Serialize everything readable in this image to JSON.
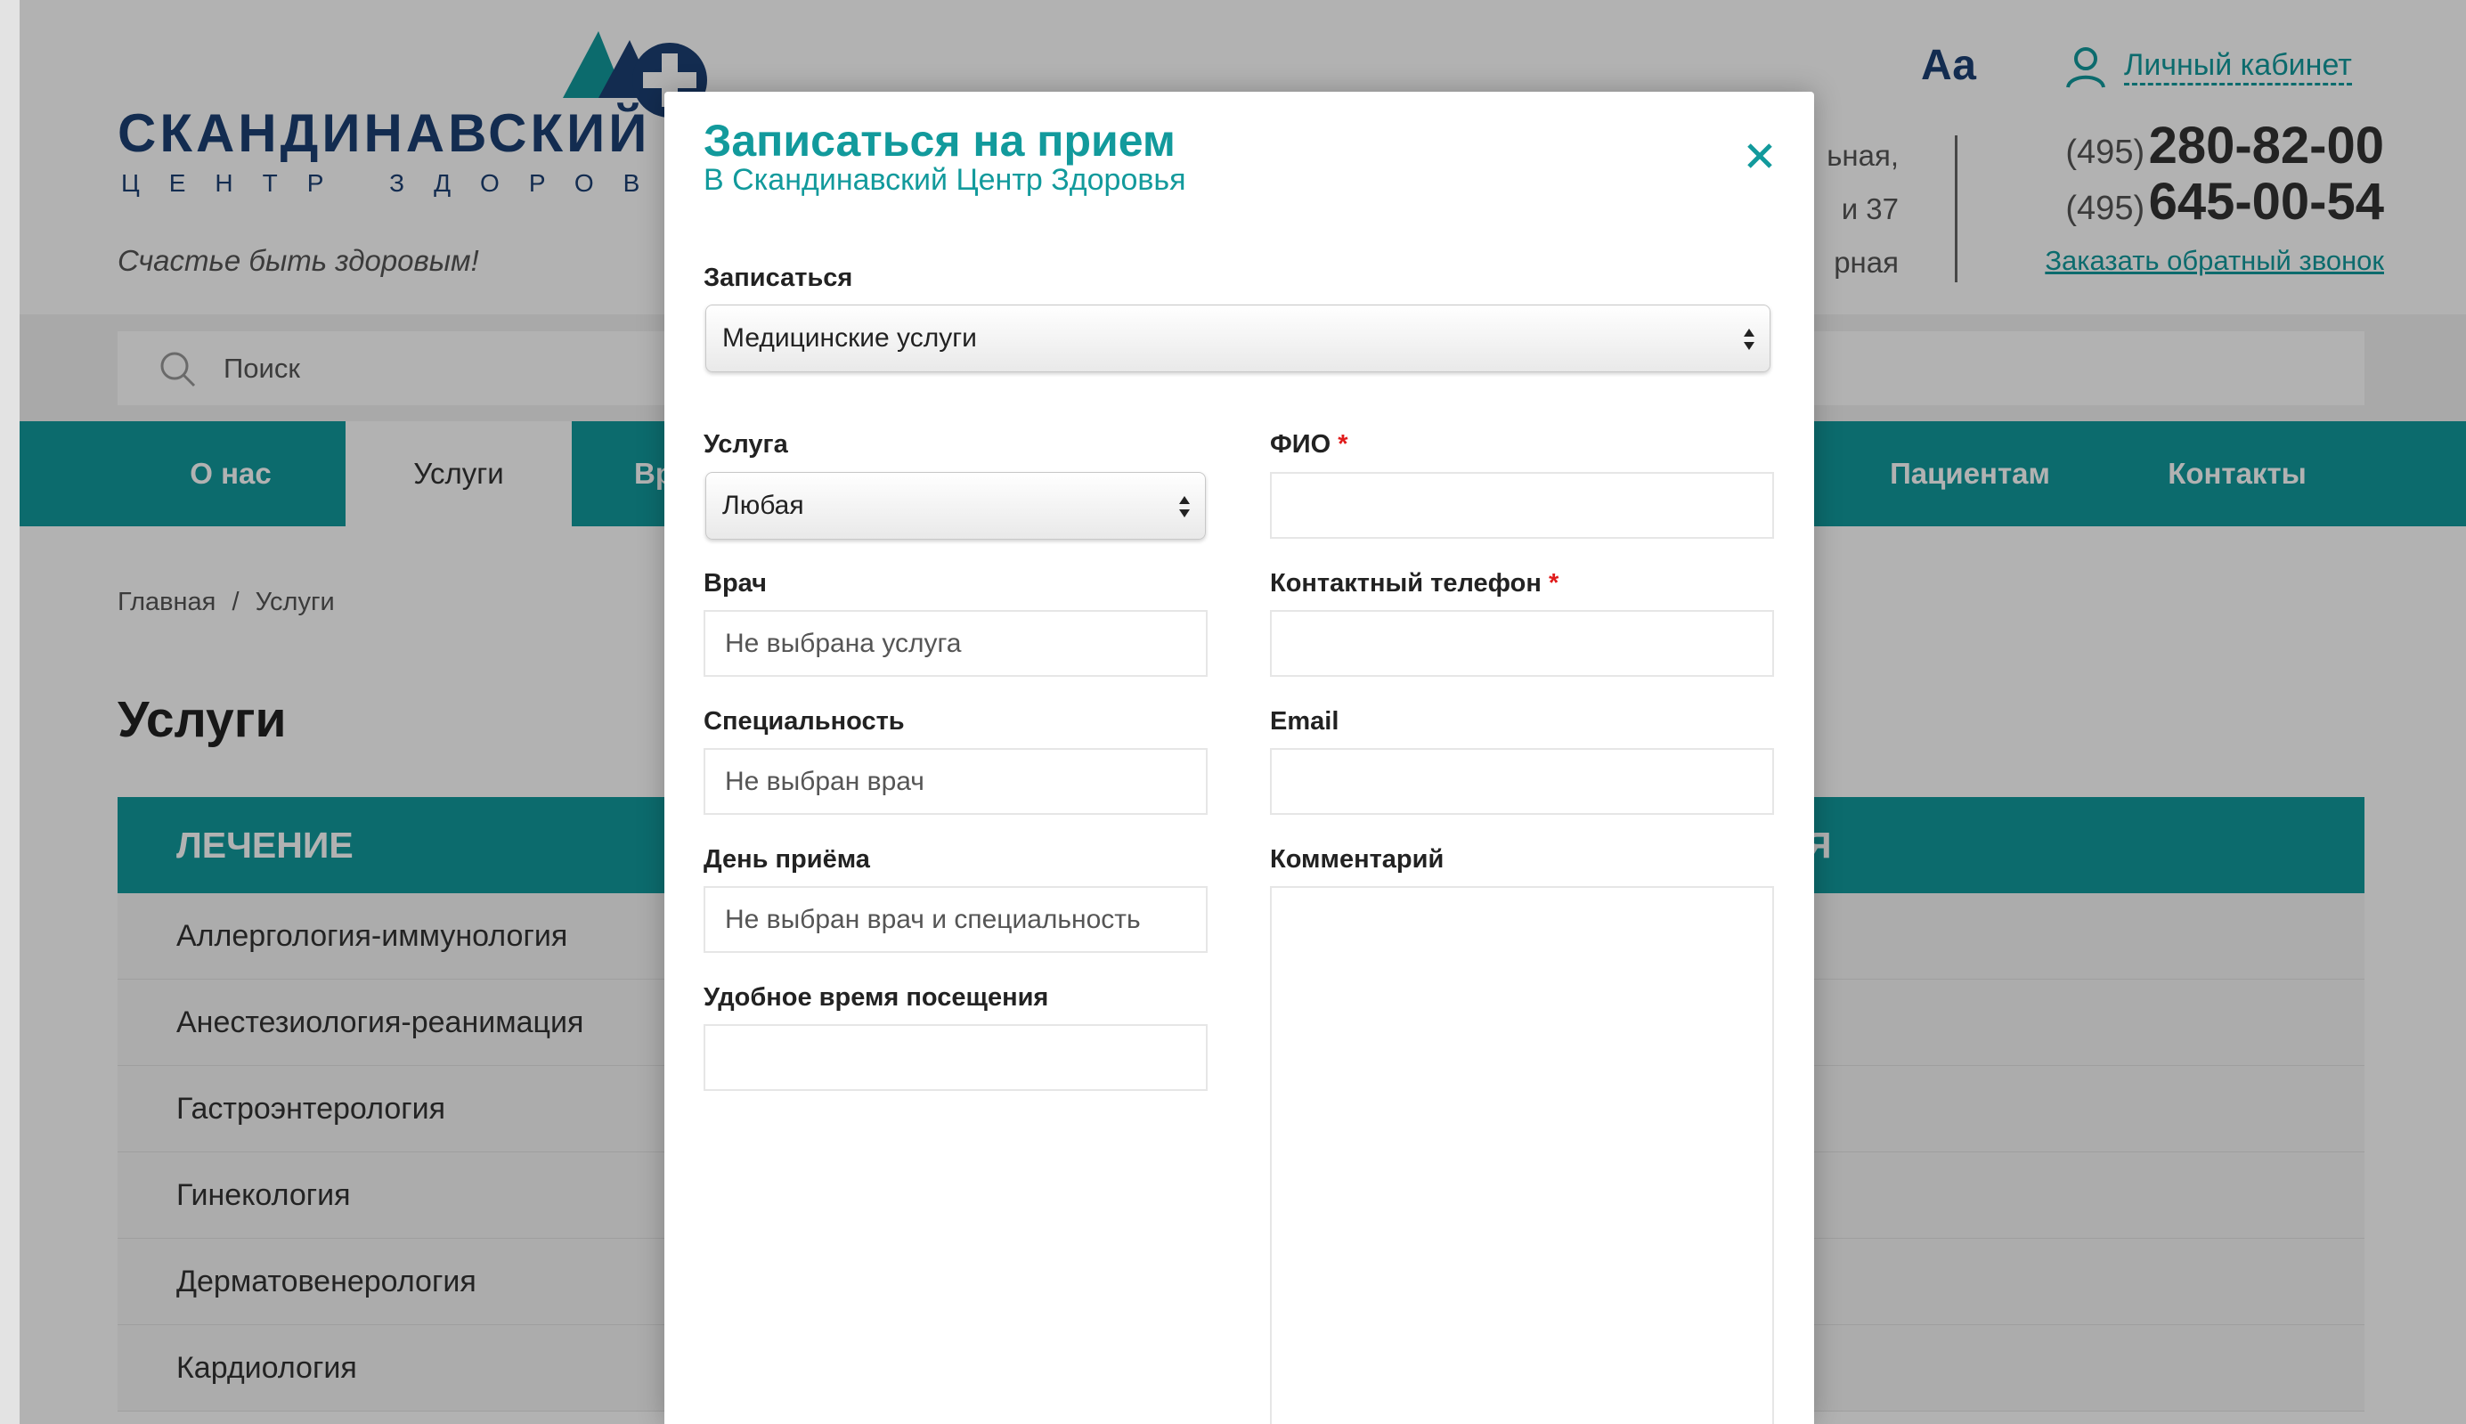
{
  "header": {
    "logo_name": "СКАНДИНАВСКИЙ",
    "logo_sub": "ЦЕНТР ЗДОРОВЬЯ",
    "slogan": "Счастье быть здоровым!",
    "font_toggle": "Аа",
    "cabinet_label": "Личный кабинет",
    "address_lines": [
      "ьная,",
      "и 37",
      "рная"
    ],
    "phones": [
      {
        "code": "(495)",
        "number": "280-82-00"
      },
      {
        "code": "(495)",
        "number": "645-00-54"
      }
    ],
    "callback_label": "Заказать обратный звонок"
  },
  "search": {
    "placeholder": "Поиск"
  },
  "nav": {
    "items": [
      "О нас",
      "Услуги",
      "Вра",
      "Пациентам",
      "Контакты"
    ],
    "active": "Услуги"
  },
  "breadcrumb": {
    "home": "Главная",
    "separator": "/",
    "current": "Услуги"
  },
  "page_title": "Услуги",
  "category": {
    "left": "ЛЕЧЕНИЕ",
    "right_fragment": "Я"
  },
  "services": [
    "Аллергология-иммунология",
    "Анестезиология-реанимация",
    "Гастроэнтерология",
    "Гинекология",
    "Дерматовенерология",
    "Кардиология"
  ],
  "modal": {
    "title": "Записаться на прием",
    "subtitle": "В Скандинавский Центр Здоровья",
    "signup": {
      "label": "Записаться",
      "value": "Медицинские услуги"
    },
    "service": {
      "label": "Услуга",
      "value": "Любая"
    },
    "doctor": {
      "label": "Врач",
      "value": "Не выбрана услуга"
    },
    "specialty": {
      "label": "Специальность",
      "value": "Не выбран врач"
    },
    "day": {
      "label": "День приёма",
      "value": "Не выбран врач и специальность"
    },
    "time": {
      "label": "Удобное время посещения",
      "value": ""
    },
    "fio": {
      "label": "ФИО",
      "required_mark": "*"
    },
    "phone": {
      "label": "Контактный телефон",
      "required_mark": "*"
    },
    "email": {
      "label": "Email"
    },
    "comment": {
      "label": "Комментарий"
    }
  },
  "colors": {
    "teal": "#129a9c",
    "navy": "#1c3f73",
    "required": "#e01b1b"
  }
}
